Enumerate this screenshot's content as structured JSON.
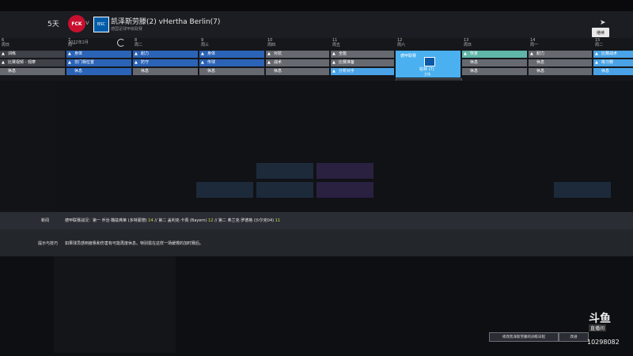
{
  "header": {
    "days_left": "5天",
    "club_logo_text": "FCK",
    "v": "v",
    "opp_logo_text": "BSC",
    "match_title": "凯泽斯劳滕(2) vHertha Berlin(7)",
    "match_sub": "德国足球甲级联赛",
    "continue_label": "继续"
  },
  "calendar": {
    "month": "2022年2月",
    "days": [
      {
        "num": "6",
        "wd": "周日",
        "s1": {
          "t": "训练",
          "c": "dkgray",
          "i": "▲"
        },
        "s2": {
          "t": "比赛视频 - 观摩",
          "c": "dkgray",
          "i": "▲"
        },
        "s3": {
          "t": "休息",
          "c": "gray",
          "i": ""
        }
      },
      {
        "num": "7",
        "wd": "周一",
        "s1": {
          "t": "身体",
          "c": "blue",
          "i": "▲"
        },
        "s2": {
          "t": "非门相位置",
          "c": "blue",
          "i": "▲"
        },
        "s3": {
          "t": "休息",
          "c": "blue",
          "i": ""
        }
      },
      {
        "num": "8",
        "wd": "周二",
        "s1": {
          "t": "耐力",
          "c": "blue",
          "i": "▲"
        },
        "s2": {
          "t": "防守",
          "c": "blue",
          "i": "▲"
        },
        "s3": {
          "t": "休息",
          "c": "gray",
          "i": ""
        }
      },
      {
        "num": "9",
        "wd": "周三",
        "s1": {
          "t": "身体",
          "c": "blue",
          "i": "▲"
        },
        "s2": {
          "t": "传球",
          "c": "blue",
          "i": "▲"
        },
        "s3": {
          "t": "休息",
          "c": "gray",
          "i": ""
        }
      },
      {
        "num": "10",
        "wd": "周四",
        "s1": {
          "t": "对抗",
          "c": "gray",
          "i": "▲"
        },
        "s2": {
          "t": "战术",
          "c": "gray",
          "i": "▲"
        },
        "s3": {
          "t": "休息",
          "c": "gray",
          "i": ""
        }
      },
      {
        "num": "11",
        "wd": "周五",
        "s1": {
          "t": "全能",
          "c": "gray",
          "i": "▲"
        },
        "s2": {
          "t": "比赛准备",
          "c": "gray",
          "i": "▲"
        },
        "s3": {
          "t": "分析对手",
          "c": "light",
          "i": "▲"
        }
      },
      {
        "num": "13",
        "wd": "周日",
        "s1": {
          "t": "恢复",
          "c": "teal",
          "i": "▲"
        },
        "s2": {
          "t": "休息",
          "c": "gray",
          "i": ""
        },
        "s3": {
          "t": "休息",
          "c": "gray",
          "i": ""
        }
      },
      {
        "num": "14",
        "wd": "周一",
        "s1": {
          "t": "耐力",
          "c": "gray",
          "i": "▲"
        },
        "s2": {
          "t": "休息",
          "c": "gray",
          "i": ""
        },
        "s3": {
          "t": "休息",
          "c": "gray",
          "i": ""
        }
      },
      {
        "num": "15",
        "wd": "周二",
        "s1": {
          "t": "比赛战术",
          "c": "light",
          "i": "▲"
        },
        "s2": {
          "t": "练习赛",
          "c": "light",
          "i": "▲"
        },
        "s3": {
          "t": "休息",
          "c": "light",
          "i": ""
        }
      }
    ],
    "match_day": {
      "num": "12",
      "wd": "周六",
      "title": "德甲联赛",
      "name": "柏林 (7)",
      "badge": "主场"
    }
  },
  "tooltip": {
    "l1": "下次比赛安排",
    "l2": "凯泽斯劳滕对柏林赫塔",
    "l3": "主场"
  },
  "news": {
    "label": "新闻",
    "text_a": "德甲联赛战况：第一 乔治·魏兹弗莱 (多特蒙德) ",
    "num_a": "14",
    "text_b": " // 第二 盖利克·卡佩 (Bayern) ",
    "num_b": "12",
    "text_c": " // 第二 弗兰克·罗德格 (沙尔克04) ",
    "num_c": "11"
  },
  "advice": {
    "label": "提示与技巧",
    "text": "如果球员感到疲惫和伤害有可能再度休息。特别需在这样一场缓慢的加时赛后。"
  },
  "buttons": {
    "a": "修改凯泽斯劳滕的训练日程",
    "b": "改进"
  },
  "watermark": {
    "logo": "斗鱼",
    "sub": "直播间",
    "num": "10298082"
  }
}
